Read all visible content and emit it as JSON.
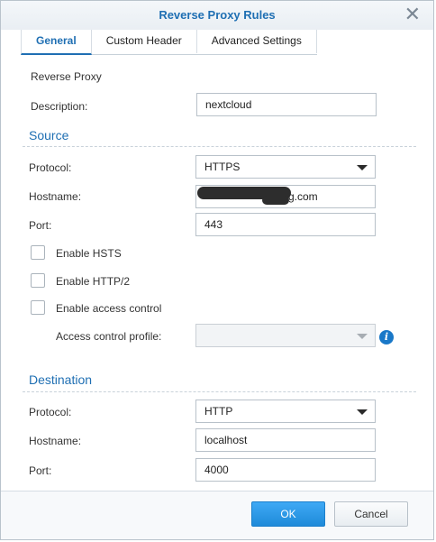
{
  "dialog": {
    "title": "Reverse Proxy Rules",
    "close_glyph": "✕"
  },
  "tabs": [
    {
      "label": "General",
      "active": true
    },
    {
      "label": "Custom Header",
      "active": false
    },
    {
      "label": "Advanced Settings",
      "active": false
    }
  ],
  "general": {
    "section_label": "Reverse Proxy",
    "description_label": "Description:",
    "description_value": "nextcloud"
  },
  "source": {
    "title": "Source",
    "protocol_label": "Protocol:",
    "protocol_value": "HTTPS",
    "hostname_label": "Hostname:",
    "hostname_value": "g.com",
    "port_label": "Port:",
    "port_value": "443",
    "enable_hsts_label": "Enable HSTS",
    "enable_hsts_checked": false,
    "enable_http2_label": "Enable HTTP/2",
    "enable_http2_checked": false,
    "enable_access_control_label": "Enable access control",
    "enable_access_control_checked": false,
    "access_control_profile_label": "Access control profile:",
    "access_control_profile_value": ""
  },
  "destination": {
    "title": "Destination",
    "protocol_label": "Protocol:",
    "protocol_value": "HTTP",
    "hostname_label": "Hostname:",
    "hostname_value": "localhost",
    "port_label": "Port:",
    "port_value": "4000"
  },
  "footer": {
    "ok_label": "OK",
    "cancel_label": "Cancel"
  },
  "icons": {
    "info": "i"
  },
  "colors": {
    "accent": "#1f6fb3",
    "ok_button": "#2b96e6"
  }
}
